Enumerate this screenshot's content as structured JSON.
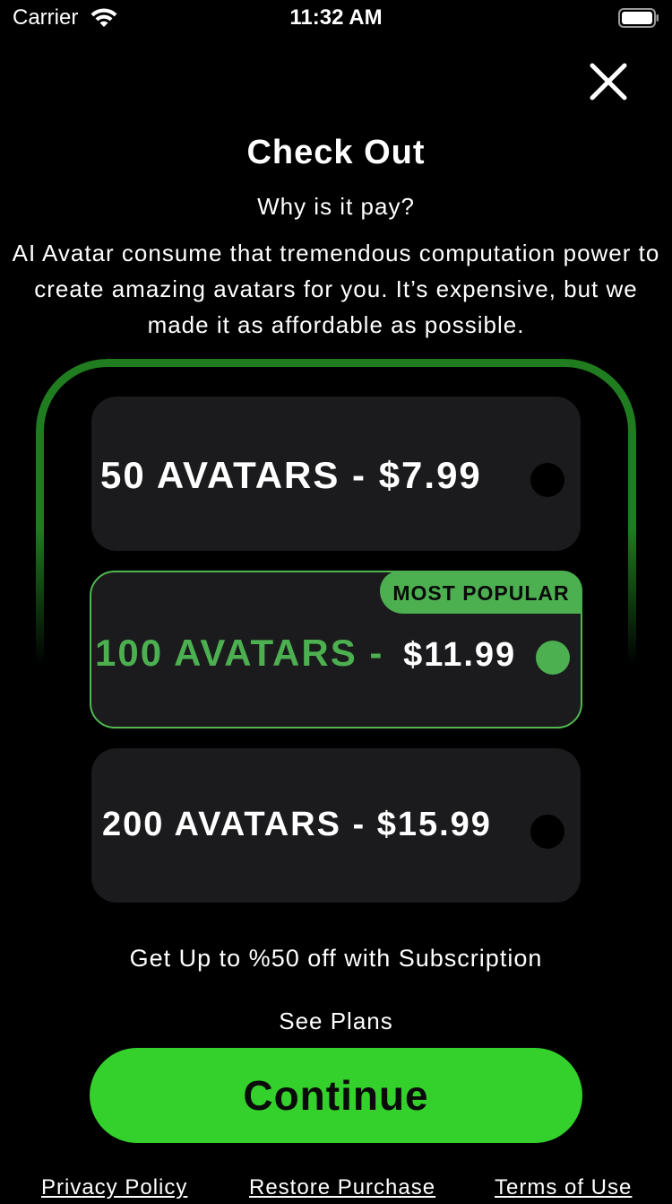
{
  "status_bar": {
    "carrier": "Carrier",
    "time": "11:32 AM",
    "wifi_icon": "wifi-icon",
    "battery_icon": "battery-icon"
  },
  "close_icon": "close-icon",
  "header": {
    "title": "Check Out",
    "subtitle": "Why is it pay?",
    "description": "AI Avatar consume that tremendous computation power to create amazing avatars for you. It’s expensive, but we made it as affordable as possible."
  },
  "plans": [
    {
      "label": "50 AVATARS - $7.99",
      "selected": false
    },
    {
      "name": "100 AVATARS - ",
      "price": "$11.99",
      "badge": "MOST POPULAR",
      "selected": true
    },
    {
      "label": "200 AVATARS - $15.99",
      "selected": false
    }
  ],
  "promo_text": "Get Up to %50 off with Subscription",
  "see_plans_label": "See Plans",
  "continue_label": "Continue",
  "footer": {
    "privacy": "Privacy Policy",
    "restore": "Restore Purchase",
    "terms": "Terms of Use"
  },
  "colors": {
    "background": "#000000",
    "accent_green": "#34d12c",
    "selected_green": "#4caf50",
    "frame_green": "#1f7d1f",
    "card": "#1b1b1d"
  }
}
